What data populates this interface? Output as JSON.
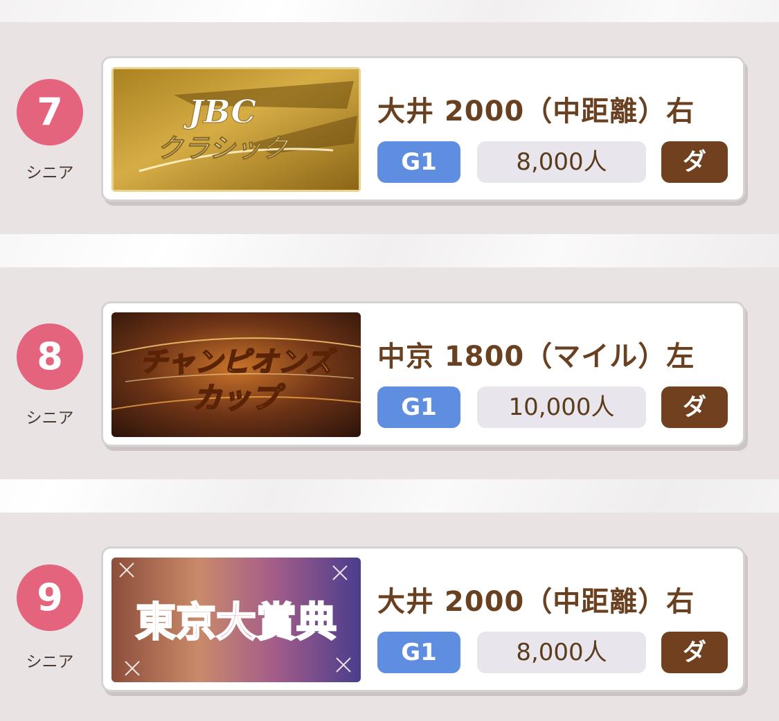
{
  "races": [
    {
      "number": "7",
      "category": "シニア",
      "banner_title_line1": "JBC",
      "banner_title_line2": "クラシック",
      "venue_distance": "大井 2000（中距離）右",
      "grade": "G1",
      "fans": "8,000人",
      "surface": "ダ"
    },
    {
      "number": "8",
      "category": "シニア",
      "banner_title_line1": "チャンピオンズ",
      "banner_title_line2": "カップ",
      "venue_distance": "中京 1800（マイル）左",
      "grade": "G1",
      "fans": "10,000人",
      "surface": "ダ"
    },
    {
      "number": "9",
      "category": "シニア",
      "banner_title_line1": "東京大賞典",
      "venue_distance": "大井 2000（中距離）右",
      "grade": "G1",
      "fans": "8,000人",
      "surface": "ダ"
    }
  ],
  "colors": {
    "number_badge": "#e5647d",
    "grade_g1": "#5f8ee0",
    "surface_dirt": "#70401f",
    "title_text": "#6a4120"
  }
}
